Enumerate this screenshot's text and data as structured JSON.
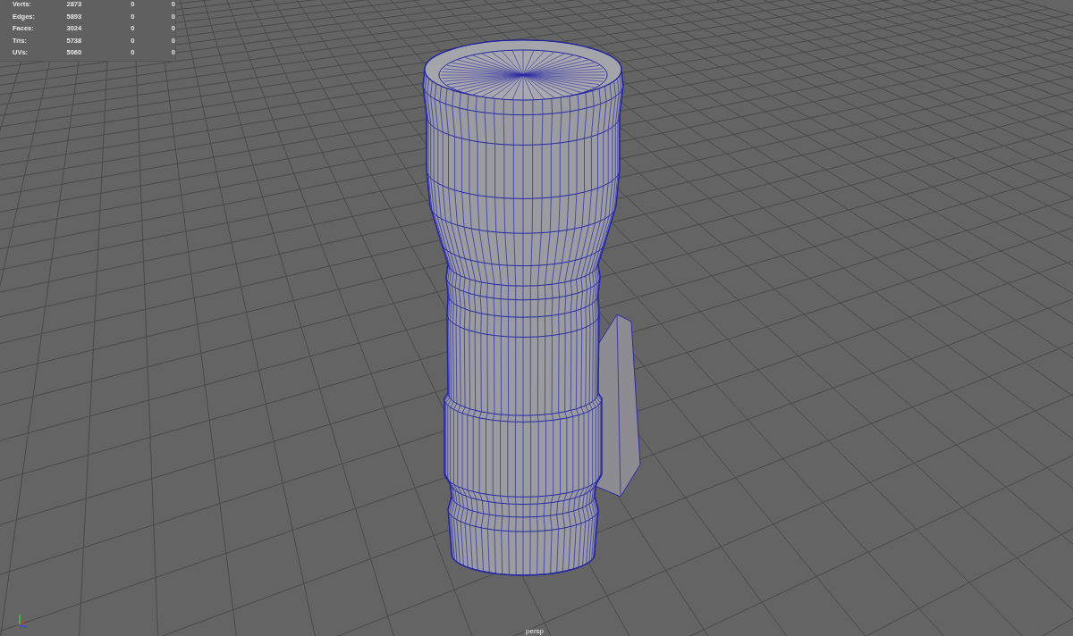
{
  "stats": [
    {
      "label": "Verts:",
      "values": [
        "2873",
        "0",
        "0"
      ]
    },
    {
      "label": "Edges:",
      "values": [
        "5893",
        "0",
        "0"
      ]
    },
    {
      "label": "Faces:",
      "values": [
        "3024",
        "0",
        "0"
      ]
    },
    {
      "label": "Tris:",
      "values": [
        "5738",
        "0",
        "0"
      ]
    },
    {
      "label": "UVs:",
      "values": [
        "5060",
        "0",
        "0"
      ]
    }
  ],
  "camera": "persp"
}
